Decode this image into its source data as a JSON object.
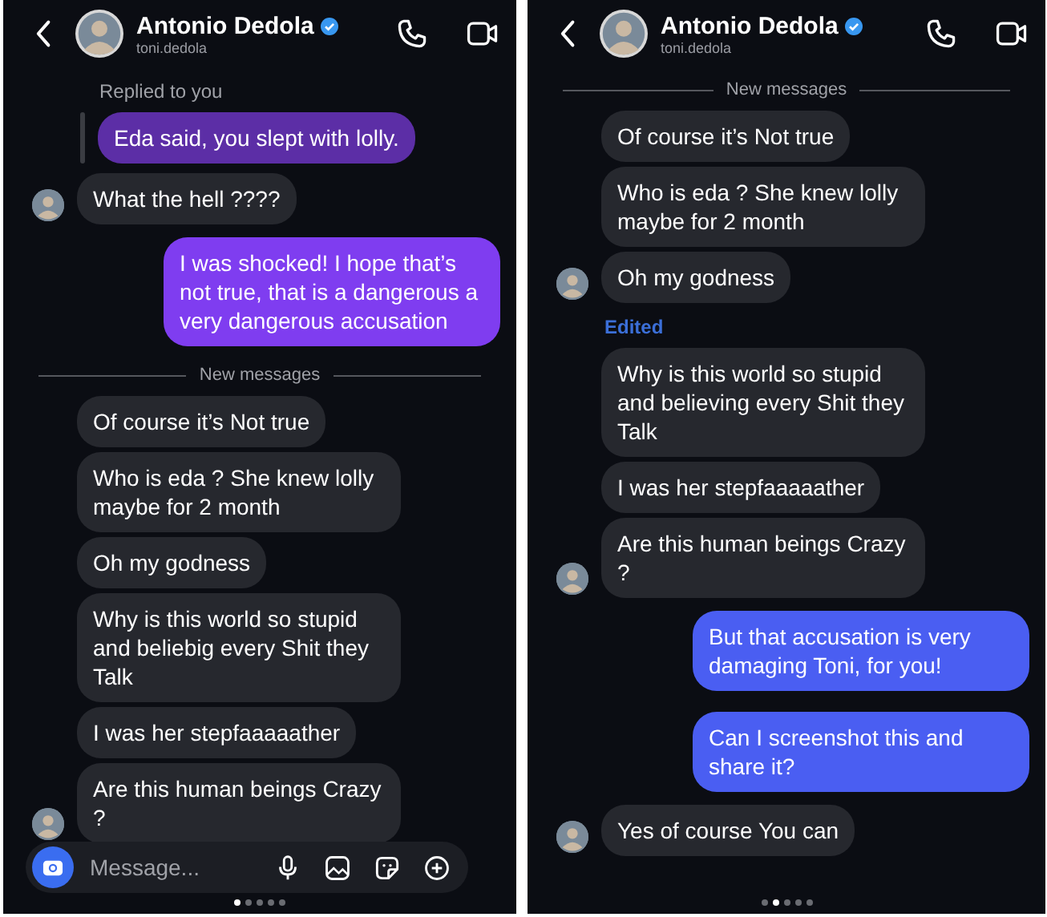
{
  "panels": [
    {
      "header": {
        "name": "Antonio Dedola",
        "username": "toni.dedola",
        "verified": true
      },
      "messages": [
        {
          "kind": "reply_note",
          "text": "Replied to you"
        },
        {
          "kind": "quote",
          "text": "Eda said, you slept with lolly.",
          "color": "#5c2ea6"
        },
        {
          "kind": "incoming",
          "text": "What the hell ????",
          "avatar": true
        },
        {
          "kind": "outgoing",
          "text": "I was shocked! I hope that’s not true, that is a dangerous a very dangerous accusation",
          "color": "#7f3df0"
        },
        {
          "kind": "divider",
          "text": "New messages"
        },
        {
          "kind": "incoming",
          "text": "Of course it’s Not true",
          "avatar": false
        },
        {
          "kind": "incoming",
          "text": "Who is eda ? She knew lolly maybe for 2 month",
          "avatar": false
        },
        {
          "kind": "incoming",
          "text": "Oh my godness",
          "avatar": false
        },
        {
          "kind": "incoming",
          "text": "Why is this world so stupid and beliebig every Shit they Talk",
          "avatar": false
        },
        {
          "kind": "incoming",
          "text": "I was her stepfaaaaather",
          "avatar": false
        },
        {
          "kind": "incoming",
          "text": "Are this human beings Crazy ?",
          "avatar": true
        }
      ],
      "composer": {
        "placeholder": "Message..."
      },
      "page_dots": [
        {
          "selected": true
        },
        {
          "selected": false
        },
        {
          "selected": false
        },
        {
          "selected": false
        },
        {
          "selected": false
        }
      ]
    },
    {
      "header": {
        "name": "Antonio Dedola",
        "username": "toni.dedola",
        "verified": true
      },
      "messages": [
        {
          "kind": "divider",
          "text": "New messages"
        },
        {
          "kind": "incoming",
          "text": "Of course it’s Not true",
          "avatar": false
        },
        {
          "kind": "incoming",
          "text": "Who is eda ? She knew lolly maybe for 2 month",
          "avatar": false
        },
        {
          "kind": "incoming",
          "text": "Oh my godness",
          "avatar": true
        },
        {
          "kind": "edited",
          "text": "Edited"
        },
        {
          "kind": "incoming",
          "text": "Why is this world so stupid and believing every Shit they Talk",
          "avatar": false
        },
        {
          "kind": "incoming",
          "text": "I was her stepfaaaaather",
          "avatar": false
        },
        {
          "kind": "incoming",
          "text": "Are this human beings Crazy ?",
          "avatar": true
        },
        {
          "kind": "outgoing",
          "text": "But that accusation is very damaging Toni, for you!",
          "color": "#4a5ef2"
        },
        {
          "kind": "outgoing",
          "text": "Can I screenshot this and share it?",
          "color": "#4a5ef2"
        },
        {
          "kind": "incoming",
          "text": "Yes of course You can",
          "avatar": true
        }
      ],
      "page_dots": [
        {
          "selected": false
        },
        {
          "selected": true
        },
        {
          "selected": false
        },
        {
          "selected": false
        },
        {
          "selected": false
        }
      ]
    }
  ]
}
